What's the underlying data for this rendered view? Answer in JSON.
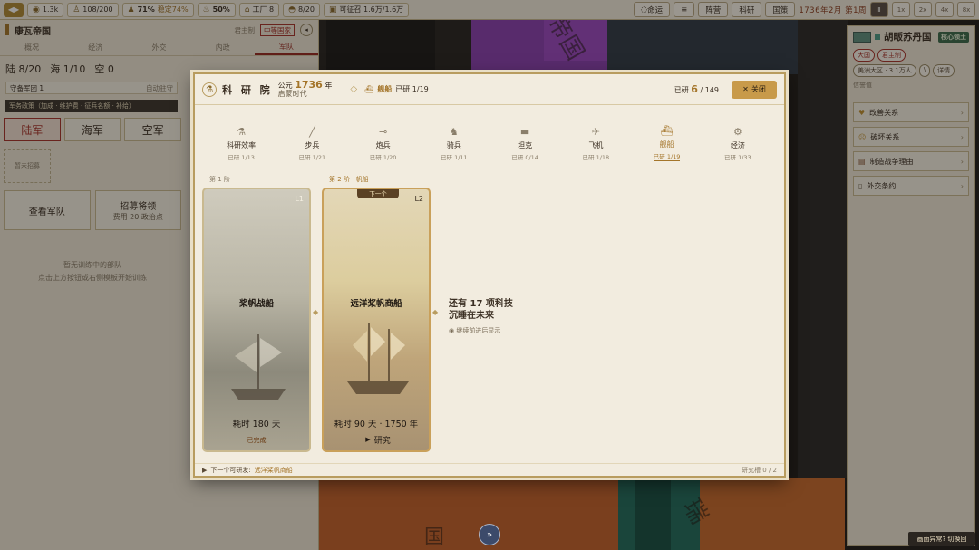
{
  "topbar": {
    "menu_icon": "swap-arrows-icon",
    "gold": "1.3k",
    "manpower": "108/200",
    "stability": "71%",
    "stability_note": "稳定74%",
    "legitimacy": "50%",
    "factories": "工厂 8",
    "units": "8/20",
    "supply": "可征召 1.6万/1.6万",
    "buttons": [
      "命运",
      "≡",
      "阵营",
      "科研",
      "国策"
    ],
    "date": "1736年2月 第1周",
    "speeds": [
      "Ⅱ",
      "1x",
      "2x",
      "4x",
      "8x"
    ]
  },
  "left_panel": {
    "nation": "康瓦帝国",
    "gov": "君主制",
    "rank": "中等国家",
    "tabs": [
      "概况",
      "经济",
      "外交",
      "内政",
      "军队"
    ],
    "counts": {
      "land": "陆 8/20",
      "sea": "海 1/10",
      "air": "空 0"
    },
    "garrison": "守备军团 1",
    "garrison_action": "自动驻守",
    "policy_bar": "军务政策（加成 · 维护费 · 征兵名额 · 补给）",
    "army_tabs": [
      "陆军",
      "海军",
      "空军"
    ],
    "empty_slot": "暂未招募",
    "view_army": "查看军队",
    "recruit": "招募将领",
    "recruit_cost": "费用 20 政治点",
    "hint1": "暂无训练中的部队",
    "hint2": "点击上方按钮或右侧模板开始训练"
  },
  "right_panel": {
    "nation": "胡畈苏丹国",
    "status": "核心领土",
    "tags": [
      "大国",
      "君主制",
      "美洲大区 · 3.1万人",
      "\\",
      "详情"
    ],
    "unknown": "信誉值",
    "actions": [
      {
        "icon": "heart-icon",
        "label": "改善关系"
      },
      {
        "icon": "angry-face-icon",
        "label": "破坏关系"
      },
      {
        "icon": "scroll-icon",
        "label": "制造战争理由"
      },
      {
        "icon": "document-icon",
        "label": "外交条约"
      }
    ]
  },
  "map_labels": [
    "帝国",
    "国",
    "瑞",
    "国"
  ],
  "modal": {
    "title": "科 研 院",
    "era_prefix": "公元",
    "year": "1736",
    "era_suffix": "年",
    "era": "启蒙时代",
    "selected_cat": "舰船",
    "selected_progress": "已研 1/19",
    "researched_label": "已研",
    "researched": "6",
    "total": "/ 149",
    "close": "关闭",
    "categories": [
      {
        "name": "科研效率",
        "count": "已研 1/13"
      },
      {
        "name": "步兵",
        "count": "已研 1/21"
      },
      {
        "name": "炮兵",
        "count": "已研 1/20"
      },
      {
        "name": "骑兵",
        "count": "已研 1/11"
      },
      {
        "name": "坦克",
        "count": "已研 0/14"
      },
      {
        "name": "飞机",
        "count": "已研 1/18"
      },
      {
        "name": "舰船",
        "count": "已研 1/19"
      },
      {
        "name": "经济",
        "count": "已研 1/33"
      }
    ],
    "stage1": "第 1 阶",
    "stage2": "第 2 阶 · 帆船",
    "next_flag": "下一个",
    "card1": {
      "level": "L1",
      "name": "桨帆战船",
      "time": "耗时 180 天",
      "status": "已完成"
    },
    "card2": {
      "level": "L2",
      "name": "远洋桨帆商船",
      "time": "耗时 90 天 · 1750 年",
      "action": "研究"
    },
    "more_line1": "还有 17 项科技",
    "more_line2": "沉睡在未来",
    "more_sub": "继续前进后显示",
    "footer_label": "下一个可研发:",
    "footer_link": "远洋桨帆商船",
    "footer_right": "研究槽 0 / 2"
  },
  "center_button": "»",
  "toast": "画面异常? 切换回"
}
